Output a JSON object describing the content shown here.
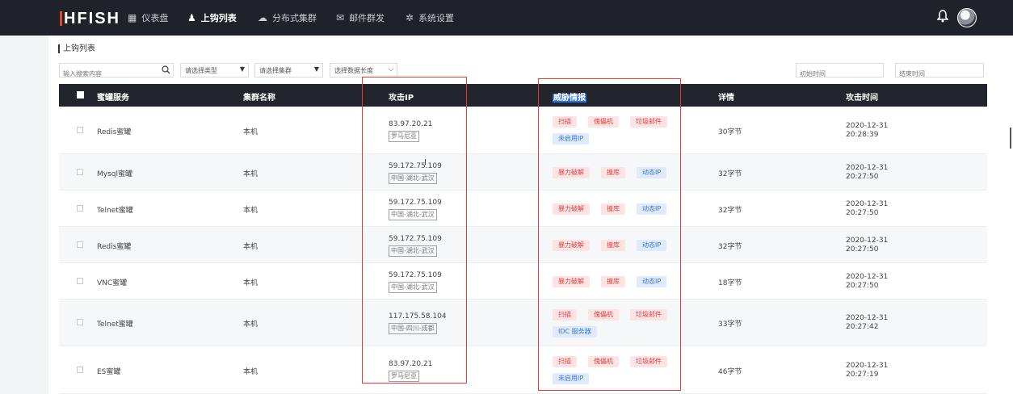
{
  "topbar": {
    "logo": "HFISH",
    "nav": [
      {
        "icon": "dashboard-icon",
        "glyph": "▦",
        "label": "仪表盘"
      },
      {
        "icon": "hacker-icon",
        "glyph": "♟",
        "label": "上钩列表"
      },
      {
        "icon": "cloud-icon",
        "glyph": "☁",
        "label": "分布式集群"
      },
      {
        "icon": "mail-icon",
        "glyph": "✉",
        "label": "邮件群发"
      },
      {
        "icon": "gear-icon",
        "glyph": "✲",
        "label": "系统设置"
      }
    ]
  },
  "breadcrumb": "上钩列表",
  "filters": {
    "search_placeholder": "输入搜索内容",
    "type_select": "请选择类型",
    "cluster_select": "请选择集群",
    "length_select": "选择数据长度",
    "start_placeholder": "初始时间",
    "end_placeholder": "结束时间"
  },
  "table": {
    "headers": {
      "service": "蜜罐服务",
      "cluster": "集群名称",
      "ip": "攻击IP",
      "intel": "威胁情报",
      "detail": "详情",
      "time": "攻击时间"
    },
    "rows": [
      {
        "service": "Redis蜜罐",
        "cluster": "本机",
        "ip": "83.97.20.21",
        "loc": "罗马尼亚",
        "tags": [
          {
            "t": "扫描",
            "c": "red"
          },
          {
            "t": "傀儡机",
            "c": "red"
          },
          {
            "t": "垃圾邮件",
            "c": "red"
          },
          {
            "t": "未启用IP",
            "c": "blue"
          }
        ],
        "detail": "30字节",
        "date": "2020-12-31",
        "clock": "20:28:39"
      },
      {
        "service": "Mysql蜜罐",
        "cluster": "本机",
        "ip": "59.172.75.109",
        "loc": "中国-湖北-武汉",
        "tags": [
          {
            "t": "暴力破解",
            "c": "red"
          },
          {
            "t": "撞库",
            "c": "red"
          },
          {
            "t": "动态IP",
            "c": "blue"
          }
        ],
        "detail": "32字节",
        "date": "2020-12-31",
        "clock": "20:27:50"
      },
      {
        "service": "Telnet蜜罐",
        "cluster": "本机",
        "ip": "59.172.75.109",
        "loc": "中国-湖北-武汉",
        "tags": [
          {
            "t": "暴力破解",
            "c": "red"
          },
          {
            "t": "撞库",
            "c": "red"
          },
          {
            "t": "动态IP",
            "c": "blue"
          }
        ],
        "detail": "32字节",
        "date": "2020-12-31",
        "clock": "20:27:50"
      },
      {
        "service": "Redis蜜罐",
        "cluster": "本机",
        "ip": "59.172.75.109",
        "loc": "中国-湖北-武汉",
        "tags": [
          {
            "t": "暴力破解",
            "c": "red"
          },
          {
            "t": "撞库",
            "c": "red"
          },
          {
            "t": "动态IP",
            "c": "blue"
          }
        ],
        "detail": "32字节",
        "date": "2020-12-31",
        "clock": "20:27:50"
      },
      {
        "service": "VNC蜜罐",
        "cluster": "本机",
        "ip": "59.172.75.109",
        "loc": "中国-湖北-武汉",
        "tags": [
          {
            "t": "暴力破解",
            "c": "red"
          },
          {
            "t": "撞库",
            "c": "red"
          },
          {
            "t": "动态IP",
            "c": "blue"
          }
        ],
        "detail": "18字节",
        "date": "2020-12-31",
        "clock": "20:27:50"
      },
      {
        "service": "Telnet蜜罐",
        "cluster": "本机",
        "ip": "117.175.58.104",
        "loc": "中国-四川-成都",
        "tags": [
          {
            "t": "扫描",
            "c": "red"
          },
          {
            "t": "傀儡机",
            "c": "red"
          },
          {
            "t": "垃圾邮件",
            "c": "red"
          },
          {
            "t": "IDC 服务器",
            "c": "blue"
          }
        ],
        "detail": "33字节",
        "date": "2020-12-31",
        "clock": "20:27:42"
      },
      {
        "service": "ES蜜罐",
        "cluster": "本机",
        "ip": "83.97.20.21",
        "loc": "罗马尼亚",
        "tags": [
          {
            "t": "扫描",
            "c": "red"
          },
          {
            "t": "傀儡机",
            "c": "red"
          },
          {
            "t": "垃圾邮件",
            "c": "red"
          },
          {
            "t": "未启用IP",
            "c": "blue"
          }
        ],
        "detail": "46字节",
        "date": "2020-12-31",
        "clock": "20:27:19"
      }
    ]
  },
  "colors": {
    "topbar": "#1f2229",
    "annotation_box": "#e53935",
    "tag_red": "#d44",
    "tag_blue": "#3a78d8"
  }
}
